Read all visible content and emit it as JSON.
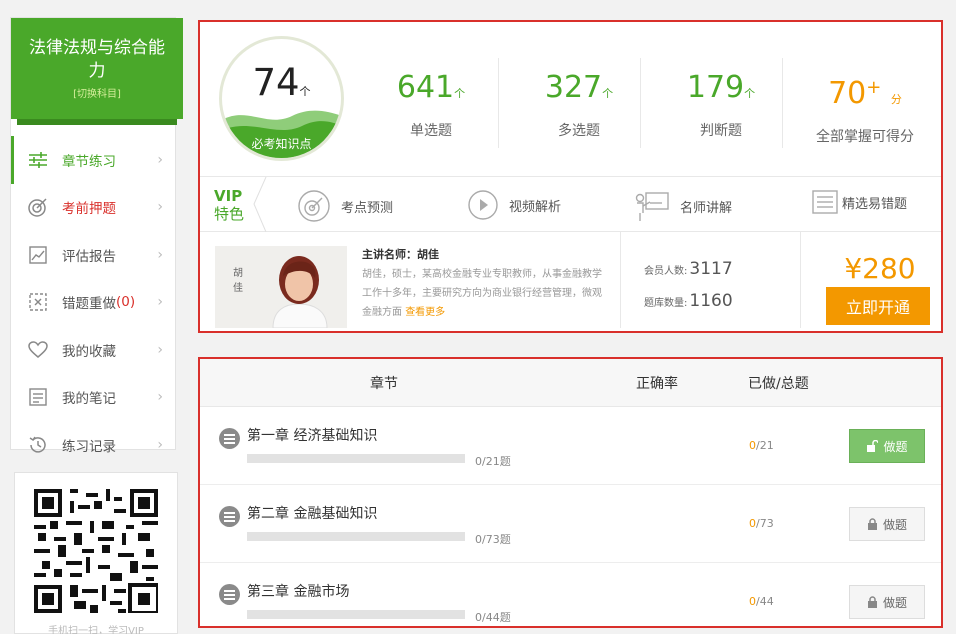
{
  "sidebar": {
    "subject_title": "法律法规与综合能力",
    "switch_label": "[切换科目]",
    "items": [
      {
        "label": "章节练习",
        "icon": "sliders-icon",
        "active": true
      },
      {
        "label": "考前押题",
        "icon": "target-icon",
        "hot": true
      },
      {
        "label": "评估报告",
        "icon": "chart-report-icon"
      },
      {
        "label": "错题重做",
        "icon": "wrong-box-icon",
        "count": "(0)"
      },
      {
        "label": "我的收藏",
        "icon": "heart-icon"
      },
      {
        "label": "我的笔记",
        "icon": "note-icon"
      },
      {
        "label": "练习记录",
        "icon": "history-icon"
      }
    ],
    "qr_caption": "手机扫一扫，学习VIP"
  },
  "summary": {
    "points_value": "74",
    "points_unit": "个",
    "points_caption": "必考知识点",
    "stats": [
      {
        "value": "641",
        "unit": "个",
        "label": "单选题"
      },
      {
        "value": "327",
        "unit": "个",
        "label": "多选题"
      },
      {
        "value": "179",
        "unit": "个",
        "label": "判断题"
      }
    ],
    "score": {
      "value": "70",
      "sup": "+",
      "unit": "分",
      "label": "全部掌握可得分"
    }
  },
  "vip": {
    "title": "VIP",
    "subtitle": "特色",
    "features": [
      {
        "label": "考点预测",
        "icon": "target-icon"
      },
      {
        "label": "视频解析",
        "icon": "play-icon"
      },
      {
        "label": "名师讲解",
        "icon": "teacher-board-icon"
      },
      {
        "label": "精选易错题",
        "icon": "list-doc-icon"
      }
    ]
  },
  "teacher": {
    "heading": "主讲名师：胡佳",
    "photo_text": "胡佳",
    "description": "胡佳，硕士，某高校金融专业专职教师，从事金融教学工作十多年，主要研究方向为商业银行经营管理，微观金融方面",
    "more_link": "查看更多",
    "members_label": "会员人数:",
    "members_value": "3117",
    "bank_label": "题库数量:",
    "bank_value": "1160",
    "price": "¥280",
    "buy_label": "立即开通"
  },
  "chapters": {
    "headers": {
      "chapter": "章节",
      "accuracy": "正确率",
      "done_total": "已做/总题"
    },
    "rows": [
      {
        "name": "第一章 经济基础知识",
        "progress_text": "0/21题",
        "done": "0",
        "total": "/21",
        "progress": 0,
        "button": "做题",
        "unlocked": true
      },
      {
        "name": "第二章 金融基础知识",
        "progress_text": "0/73题",
        "done": "0",
        "total": "/73",
        "progress": 0,
        "button": "做题",
        "unlocked": false
      },
      {
        "name": "第三章 金融市场",
        "progress_text": "0/44题",
        "done": "0",
        "total": "/44",
        "progress": 0,
        "button": "做题",
        "unlocked": false
      }
    ]
  },
  "colors": {
    "brand_green": "#4aa82a",
    "accent_orange": "#f39800",
    "highlight_red": "#d9302b"
  }
}
